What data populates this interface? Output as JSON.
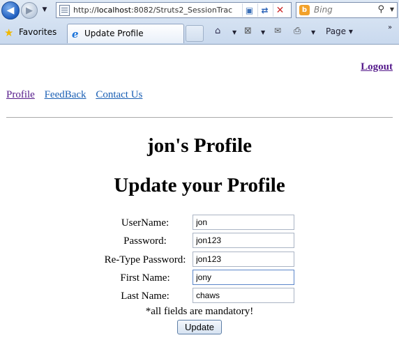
{
  "browser": {
    "url_scheme": "http://",
    "url_host": "localhost",
    "url_rest": ":8082/Struts2_SessionTrac",
    "search_placeholder": "Bing",
    "favorites_label": "Favorites",
    "tab_title": "Update Profile",
    "page_menu_label": "Page ▾"
  },
  "header": {
    "logout_label": "Logout"
  },
  "nav": {
    "items": [
      {
        "label": "Profile"
      },
      {
        "label": "FeedBack"
      },
      {
        "label": "Contact Us"
      }
    ]
  },
  "main": {
    "profile_title": "jon's Profile",
    "form_title": "Update your Profile",
    "fields": {
      "username": {
        "label": "UserName:",
        "value": "jon"
      },
      "password": {
        "label": "Password:",
        "value": "jon123"
      },
      "retype_password": {
        "label": "Re-Type Password:",
        "value": "jon123"
      },
      "first_name": {
        "label": "First Name:",
        "value": "jony"
      },
      "last_name": {
        "label": "Last Name:",
        "value": "chaws"
      }
    },
    "mandatory_note": "*all fields are mandatory!",
    "submit_label": "Update"
  },
  "colors": {
    "visited_link": "#551a8b",
    "link": "#1a5fb4",
    "chrome_bg": "#c9d9ee"
  },
  "icons": {
    "back": "back-arrow-icon",
    "forward": "forward-arrow-icon",
    "page": "page-icon",
    "compat": "compatibility-view-icon",
    "refresh": "refresh-icon",
    "stop": "stop-icon",
    "search": "search-icon",
    "favorites": "favorites-star-icon",
    "ie": "ie-logo-icon",
    "home": "home-icon",
    "feeds": "rss-feed-icon",
    "mail": "mail-icon",
    "print": "print-icon"
  }
}
